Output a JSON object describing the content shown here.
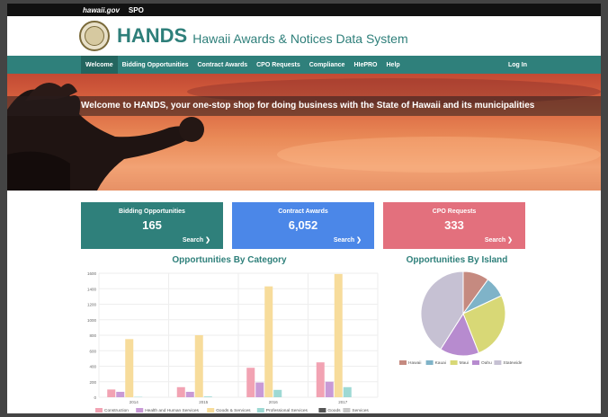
{
  "topbar": {
    "gov_link": "hawaii.gov",
    "spo_link": "SPO"
  },
  "brand": {
    "title": "HANDS",
    "subtitle": "Hawaii Awards & Notices Data System"
  },
  "nav": {
    "items": [
      "Welcome",
      "Bidding Opportunities",
      "Contract Awards",
      "CPO Requests",
      "Compliance",
      "HIePRO",
      "Help"
    ],
    "login": "Log In"
  },
  "hero": {
    "text": "Welcome to HANDS, your one-stop shop for doing business with the State of Hawaii and its municipalities"
  },
  "cards": [
    {
      "title": "Bidding Opportunities",
      "value": "165",
      "link": "Search ❯",
      "color": "#2f807b"
    },
    {
      "title": "Contract Awards",
      "value": "6,052",
      "link": "Search ❯",
      "color": "#4b87e8"
    },
    {
      "title": "CPO Requests",
      "value": "333",
      "link": "Search ❯",
      "color": "#e3707d"
    }
  ],
  "chart_titles": {
    "bar": "Opportunities By Category",
    "pie": "Opportunities By Island"
  },
  "chart_data": [
    {
      "type": "bar",
      "title": "Opportunities By Category",
      "categories": [
        "2014",
        "2015",
        "2016",
        "2017"
      ],
      "ylim": [
        0,
        1600
      ],
      "yticks": [
        0,
        200,
        400,
        600,
        800,
        1000,
        1200,
        1400,
        1600
      ],
      "grid": true,
      "legend": "bottom",
      "series": [
        {
          "name": "Construction",
          "color": "#f2a3b3",
          "values": [
            100,
            130,
            380,
            450
          ]
        },
        {
          "name": "Health and Human Services",
          "color": "#c99ad6",
          "values": [
            70,
            70,
            190,
            200
          ]
        },
        {
          "name": "Goods & Services",
          "color": "#f7dc9b",
          "values": [
            750,
            800,
            1430,
            1590
          ]
        },
        {
          "name": "Professional Services",
          "color": "#9ed9d4",
          "values": [
            5,
            10,
            95,
            130
          ]
        },
        {
          "name": "Goods",
          "color": "#555555",
          "values": [
            0,
            0,
            0,
            0
          ]
        },
        {
          "name": "Services",
          "color": "#c8c8c8",
          "values": [
            0,
            0,
            0,
            0
          ]
        }
      ]
    },
    {
      "type": "pie",
      "title": "Opportunities By Island",
      "legend": "bottom",
      "series": [
        {
          "name": "Hawaii",
          "color": "#c58a80",
          "value": 10
        },
        {
          "name": "Kauai",
          "color": "#7fb3c8",
          "value": 8
        },
        {
          "name": "Maui",
          "color": "#d8d876",
          "value": 26
        },
        {
          "name": "Oahu",
          "color": "#b78bcf",
          "value": 15
        },
        {
          "name": "Statewide",
          "color": "#c6c1d3",
          "value": 41
        }
      ]
    }
  ]
}
